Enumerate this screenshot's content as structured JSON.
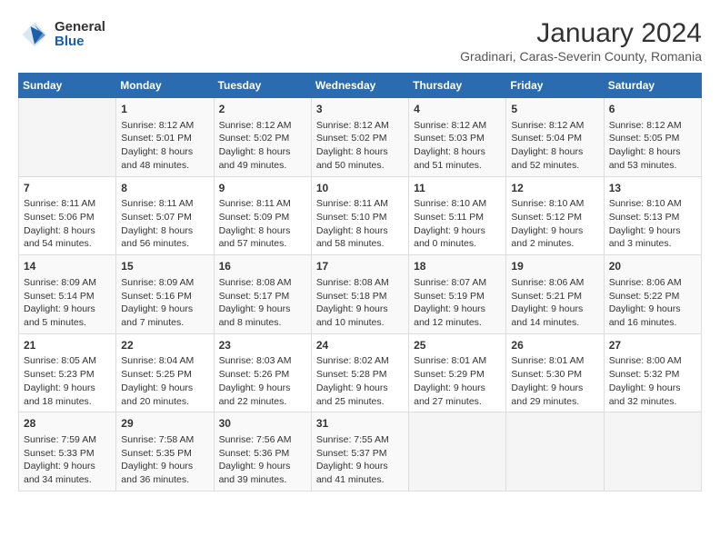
{
  "logo": {
    "general": "General",
    "blue": "Blue"
  },
  "title": "January 2024",
  "subtitle": "Gradinari, Caras-Severin County, Romania",
  "days_of_week": [
    "Sunday",
    "Monday",
    "Tuesday",
    "Wednesday",
    "Thursday",
    "Friday",
    "Saturday"
  ],
  "weeks": [
    [
      {
        "day": "",
        "content": ""
      },
      {
        "day": "1",
        "content": "Sunrise: 8:12 AM\nSunset: 5:01 PM\nDaylight: 8 hours\nand 48 minutes."
      },
      {
        "day": "2",
        "content": "Sunrise: 8:12 AM\nSunset: 5:02 PM\nDaylight: 8 hours\nand 49 minutes."
      },
      {
        "day": "3",
        "content": "Sunrise: 8:12 AM\nSunset: 5:02 PM\nDaylight: 8 hours\nand 50 minutes."
      },
      {
        "day": "4",
        "content": "Sunrise: 8:12 AM\nSunset: 5:03 PM\nDaylight: 8 hours\nand 51 minutes."
      },
      {
        "day": "5",
        "content": "Sunrise: 8:12 AM\nSunset: 5:04 PM\nDaylight: 8 hours\nand 52 minutes."
      },
      {
        "day": "6",
        "content": "Sunrise: 8:12 AM\nSunset: 5:05 PM\nDaylight: 8 hours\nand 53 minutes."
      }
    ],
    [
      {
        "day": "7",
        "content": "Sunrise: 8:11 AM\nSunset: 5:06 PM\nDaylight: 8 hours\nand 54 minutes."
      },
      {
        "day": "8",
        "content": "Sunrise: 8:11 AM\nSunset: 5:07 PM\nDaylight: 8 hours\nand 56 minutes."
      },
      {
        "day": "9",
        "content": "Sunrise: 8:11 AM\nSunset: 5:09 PM\nDaylight: 8 hours\nand 57 minutes."
      },
      {
        "day": "10",
        "content": "Sunrise: 8:11 AM\nSunset: 5:10 PM\nDaylight: 8 hours\nand 58 minutes."
      },
      {
        "day": "11",
        "content": "Sunrise: 8:10 AM\nSunset: 5:11 PM\nDaylight: 9 hours\nand 0 minutes."
      },
      {
        "day": "12",
        "content": "Sunrise: 8:10 AM\nSunset: 5:12 PM\nDaylight: 9 hours\nand 2 minutes."
      },
      {
        "day": "13",
        "content": "Sunrise: 8:10 AM\nSunset: 5:13 PM\nDaylight: 9 hours\nand 3 minutes."
      }
    ],
    [
      {
        "day": "14",
        "content": "Sunrise: 8:09 AM\nSunset: 5:14 PM\nDaylight: 9 hours\nand 5 minutes."
      },
      {
        "day": "15",
        "content": "Sunrise: 8:09 AM\nSunset: 5:16 PM\nDaylight: 9 hours\nand 7 minutes."
      },
      {
        "day": "16",
        "content": "Sunrise: 8:08 AM\nSunset: 5:17 PM\nDaylight: 9 hours\nand 8 minutes."
      },
      {
        "day": "17",
        "content": "Sunrise: 8:08 AM\nSunset: 5:18 PM\nDaylight: 9 hours\nand 10 minutes."
      },
      {
        "day": "18",
        "content": "Sunrise: 8:07 AM\nSunset: 5:19 PM\nDaylight: 9 hours\nand 12 minutes."
      },
      {
        "day": "19",
        "content": "Sunrise: 8:06 AM\nSunset: 5:21 PM\nDaylight: 9 hours\nand 14 minutes."
      },
      {
        "day": "20",
        "content": "Sunrise: 8:06 AM\nSunset: 5:22 PM\nDaylight: 9 hours\nand 16 minutes."
      }
    ],
    [
      {
        "day": "21",
        "content": "Sunrise: 8:05 AM\nSunset: 5:23 PM\nDaylight: 9 hours\nand 18 minutes."
      },
      {
        "day": "22",
        "content": "Sunrise: 8:04 AM\nSunset: 5:25 PM\nDaylight: 9 hours\nand 20 minutes."
      },
      {
        "day": "23",
        "content": "Sunrise: 8:03 AM\nSunset: 5:26 PM\nDaylight: 9 hours\nand 22 minutes."
      },
      {
        "day": "24",
        "content": "Sunrise: 8:02 AM\nSunset: 5:28 PM\nDaylight: 9 hours\nand 25 minutes."
      },
      {
        "day": "25",
        "content": "Sunrise: 8:01 AM\nSunset: 5:29 PM\nDaylight: 9 hours\nand 27 minutes."
      },
      {
        "day": "26",
        "content": "Sunrise: 8:01 AM\nSunset: 5:30 PM\nDaylight: 9 hours\nand 29 minutes."
      },
      {
        "day": "27",
        "content": "Sunrise: 8:00 AM\nSunset: 5:32 PM\nDaylight: 9 hours\nand 32 minutes."
      }
    ],
    [
      {
        "day": "28",
        "content": "Sunrise: 7:59 AM\nSunset: 5:33 PM\nDaylight: 9 hours\nand 34 minutes."
      },
      {
        "day": "29",
        "content": "Sunrise: 7:58 AM\nSunset: 5:35 PM\nDaylight: 9 hours\nand 36 minutes."
      },
      {
        "day": "30",
        "content": "Sunrise: 7:56 AM\nSunset: 5:36 PM\nDaylight: 9 hours\nand 39 minutes."
      },
      {
        "day": "31",
        "content": "Sunrise: 7:55 AM\nSunset: 5:37 PM\nDaylight: 9 hours\nand 41 minutes."
      },
      {
        "day": "",
        "content": ""
      },
      {
        "day": "",
        "content": ""
      },
      {
        "day": "",
        "content": ""
      }
    ]
  ]
}
